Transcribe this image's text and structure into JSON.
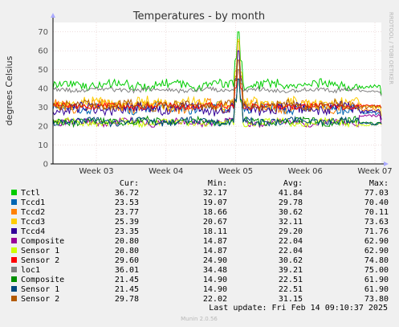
{
  "chart_data": {
    "type": "line",
    "title": "Temperatures - by month",
    "ylabel": "degrees Celsius",
    "side_label": "RRDTOOL / TOBI OETIKER",
    "ylim": [
      0,
      75
    ],
    "yticks": [
      0,
      10,
      20,
      30,
      40,
      50,
      60,
      70
    ],
    "x_ticks": [
      "Week 03",
      "Week 04",
      "Week 05",
      "Week 06",
      "Week 07"
    ],
    "grid": true,
    "legend_position": "below",
    "legend_headers": {
      "cur": "Cur:",
      "min": "Min:",
      "avg": "Avg:",
      "max": "Max:"
    },
    "series": [
      {
        "name": "Tctl",
        "color": "#00cc00",
        "cur": "36.72",
        "min": "32.17",
        "avg": "41.84",
        "max": "77.03",
        "spike": 70,
        "end": 40
      },
      {
        "name": "Tccd1",
        "color": "#0066b3",
        "cur": "23.53",
        "min": "19.07",
        "avg": "29.78",
        "max": "70.40",
        "spike": 65,
        "end": 25
      },
      {
        "name": "Tccd2",
        "color": "#ff8000",
        "cur": "23.77",
        "min": "18.66",
        "avg": "30.62",
        "max": "70.11",
        "spike": 65,
        "end": 27
      },
      {
        "name": "Tccd3",
        "color": "#ffcc00",
        "cur": "25.39",
        "min": "20.67",
        "avg": "32.11",
        "max": "73.63",
        "spike": 66,
        "end": 30
      },
      {
        "name": "Tccd4",
        "color": "#330099",
        "cur": "23.35",
        "min": "18.11",
        "avg": "29.20",
        "max": "71.76",
        "spike": 60,
        "end": 27
      },
      {
        "name": "Composite",
        "color": "#990099",
        "cur": "20.80",
        "min": "14.87",
        "avg": "22.04",
        "max": "62.90",
        "spike": 45,
        "end": 28
      },
      {
        "name": "Sensor 1",
        "color": "#ccff00",
        "cur": "20.80",
        "min": "14.87",
        "avg": "22.04",
        "max": "62.90",
        "spike": 45,
        "end": 20
      },
      {
        "name": "Sensor 2",
        "color": "#ff0000",
        "cur": "29.60",
        "min": "24.90",
        "avg": "30.62",
        "max": "74.80",
        "spike": 50,
        "end": 31
      },
      {
        "name": "loc1",
        "color": "#808080",
        "cur": "36.01",
        "min": "34.48",
        "avg": "39.21",
        "max": "75.00",
        "spike": 50,
        "end": 38
      },
      {
        "name": "Composite",
        "color": "#008f00",
        "cur": "21.45",
        "min": "14.90",
        "avg": "22.51",
        "max": "61.90",
        "spike": 45,
        "end": 21
      },
      {
        "name": "Sensor 1",
        "color": "#00487d",
        "cur": "21.45",
        "min": "14.90",
        "avg": "22.51",
        "max": "61.90",
        "spike": 45,
        "end": 21
      },
      {
        "name": "Sensor 2",
        "color": "#b35a00",
        "cur": "29.78",
        "min": "22.02",
        "avg": "31.15",
        "max": "73.80",
        "spike": 55,
        "end": 30
      }
    ],
    "last_update": "Last update: Fri Feb 14 09:10:37 2025",
    "footer": "Munin 2.0.56"
  }
}
